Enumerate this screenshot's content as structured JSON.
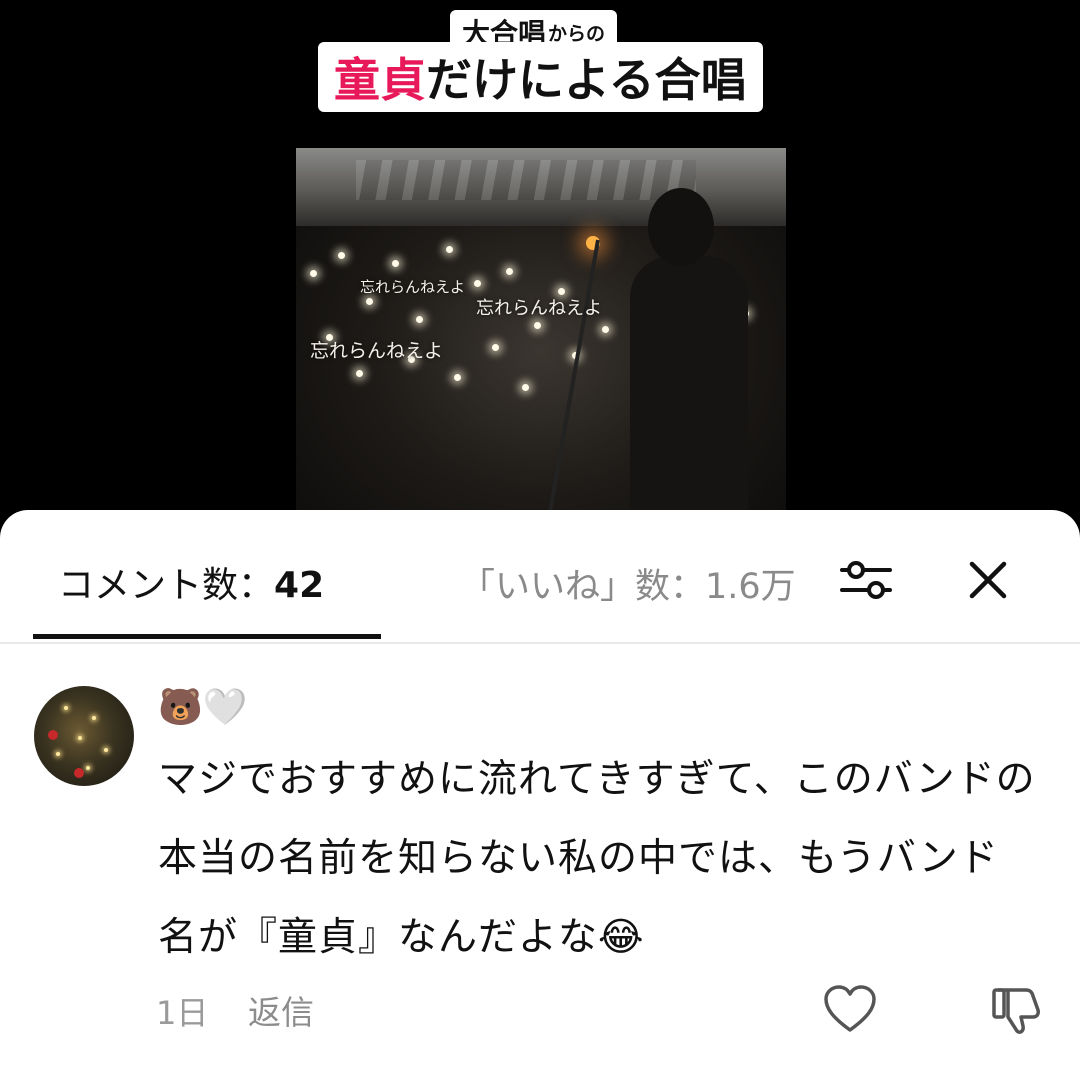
{
  "video": {
    "caption_line1": "大合唱",
    "caption_line1_small": "からの",
    "caption_line2_highlight": "童貞",
    "caption_line2_rest": "だけによる合唱",
    "overlay_texts": [
      "忘れらんねえよ",
      "忘れらんねえよ",
      "忘れらんねえよ"
    ]
  },
  "tabs": {
    "comments_label": "コメント数：",
    "comments_count": "42",
    "likes_label": "「いいね」数：1.6万"
  },
  "icons": {
    "filter": "sliders-icon",
    "close": "close-icon",
    "like": "heart-icon",
    "dislike": "thumbs-down-icon"
  },
  "comment": {
    "username": "🐻🤍",
    "text": "マジでおすすめに流れてきすぎて、このバンドの本当の名前を知らない私の中では、もうバンド名が『童貞』なんだよな😂",
    "time": "1日",
    "reply_label": "返信"
  },
  "colors": {
    "highlight": "#e8195a",
    "sheet_bg": "#ffffff",
    "video_bg": "#000000"
  }
}
